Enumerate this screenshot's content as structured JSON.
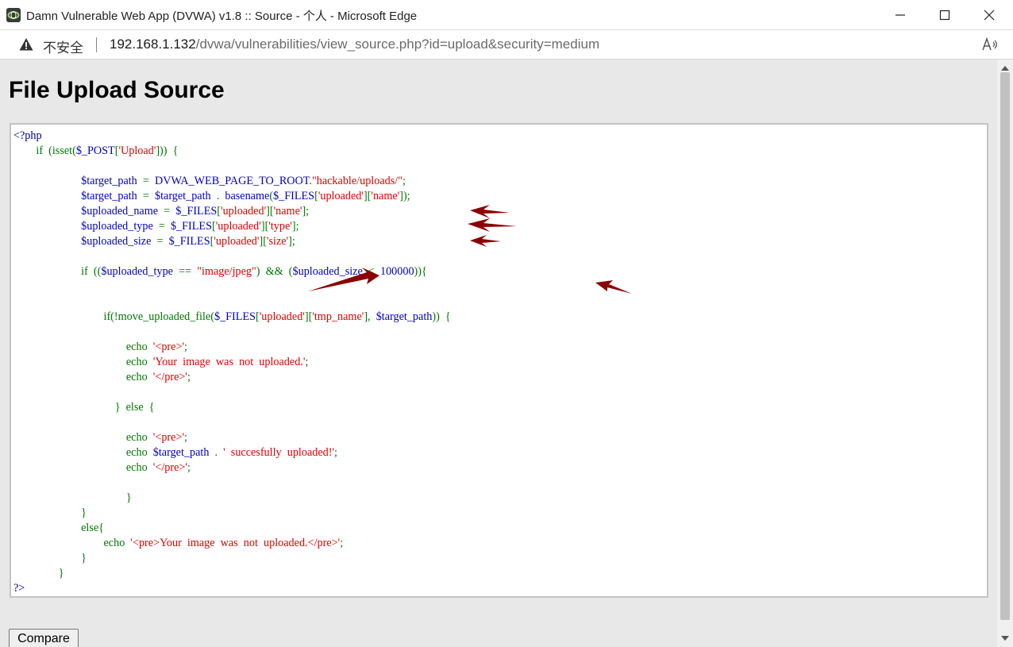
{
  "window": {
    "title": "Damn Vulnerable Web App (DVWA) v1.8 :: Source - 个人 - Microsoft Edge",
    "minimize_icon": "minimize-icon",
    "maximize_icon": "maximize-icon",
    "close_icon": "close-icon"
  },
  "addressbar": {
    "security_label": "不安全",
    "url_host": "192.168.1.132",
    "url_path": "/dvwa/vulnerabilities/view_source.php?id=upload&security=medium",
    "warning_icon": "warning-icon",
    "read_aloud_icon": "read-aloud-icon"
  },
  "page": {
    "title": "File Upload Source",
    "compare_label": "Compare"
  },
  "code": [
    [
      [
        "t",
        "<?php"
      ]
    ],
    [
      [
        "p",
        "        "
      ],
      [
        "k",
        "if  (isset("
      ],
      [
        "v",
        "$_POST"
      ],
      [
        "k",
        "["
      ],
      [
        "s",
        "'Upload'"
      ],
      [
        "k",
        "]))  {"
      ]
    ],
    [
      [
        "p",
        ""
      ]
    ],
    [
      [
        "p",
        "                        "
      ],
      [
        "v",
        "$target_path  "
      ],
      [
        "k",
        "=  "
      ],
      [
        "v",
        "DVWA_WEB_PAGE_TO_ROOT"
      ],
      [
        "k",
        "."
      ],
      [
        "s",
        "\"hackable/uploads/\""
      ],
      [
        "k",
        ";"
      ]
    ],
    [
      [
        "p",
        "                        "
      ],
      [
        "v",
        "$target_path  "
      ],
      [
        "k",
        "=  "
      ],
      [
        "v",
        "$target_path  "
      ],
      [
        "k",
        ".  "
      ],
      [
        "v",
        "basename"
      ],
      [
        "k",
        "("
      ],
      [
        "v",
        "$_FILES"
      ],
      [
        "k",
        "["
      ],
      [
        "s",
        "'uploaded'"
      ],
      [
        "k",
        "]["
      ],
      [
        "s",
        "'name'"
      ],
      [
        "k",
        "]);"
      ]
    ],
    [
      [
        "p",
        "                        "
      ],
      [
        "v",
        "$uploaded_name  "
      ],
      [
        "k",
        "=  "
      ],
      [
        "v",
        "$_FILES"
      ],
      [
        "k",
        "["
      ],
      [
        "s",
        "'uploaded'"
      ],
      [
        "k",
        "]["
      ],
      [
        "s",
        "'name'"
      ],
      [
        "k",
        "];"
      ]
    ],
    [
      [
        "p",
        "                        "
      ],
      [
        "v",
        "$uploaded_type  "
      ],
      [
        "k",
        "=  "
      ],
      [
        "v",
        "$_FILES"
      ],
      [
        "k",
        "["
      ],
      [
        "s",
        "'uploaded'"
      ],
      [
        "k",
        "]["
      ],
      [
        "s",
        "'type'"
      ],
      [
        "k",
        "];"
      ]
    ],
    [
      [
        "p",
        "                        "
      ],
      [
        "v",
        "$uploaded_size  "
      ],
      [
        "k",
        "=  "
      ],
      [
        "v",
        "$_FILES"
      ],
      [
        "k",
        "["
      ],
      [
        "s",
        "'uploaded'"
      ],
      [
        "k",
        "]["
      ],
      [
        "s",
        "'size'"
      ],
      [
        "k",
        "];"
      ]
    ],
    [
      [
        "p",
        ""
      ]
    ],
    [
      [
        "p",
        "                        "
      ],
      [
        "k",
        "if  (("
      ],
      [
        "v",
        "$uploaded_type  "
      ],
      [
        "k",
        "==  "
      ],
      [
        "s",
        "\"image/jpeg\""
      ],
      [
        "k",
        ")  &&  ("
      ],
      [
        "v",
        "$uploaded_size  "
      ],
      [
        "k",
        "<  "
      ],
      [
        "v",
        "100000"
      ],
      [
        "k",
        ")){"
      ]
    ],
    [
      [
        "p",
        ""
      ]
    ],
    [
      [
        "p",
        ""
      ]
    ],
    [
      [
        "p",
        "                                "
      ],
      [
        "k",
        "if(!move_uploaded_file("
      ],
      [
        "v",
        "$_FILES"
      ],
      [
        "k",
        "["
      ],
      [
        "s",
        "'uploaded'"
      ],
      [
        "k",
        "]["
      ],
      [
        "s",
        "'tmp_name'"
      ],
      [
        "k",
        "],  "
      ],
      [
        "v",
        "$target_path"
      ],
      [
        "k",
        "))  {"
      ]
    ],
    [
      [
        "p",
        ""
      ]
    ],
    [
      [
        "p",
        "                                        "
      ],
      [
        "k",
        "echo  "
      ],
      [
        "s",
        "'<pre>'"
      ],
      [
        "k",
        ";"
      ]
    ],
    [
      [
        "p",
        "                                        "
      ],
      [
        "k",
        "echo  "
      ],
      [
        "s",
        "'Your  image  was  not  uploaded.'"
      ],
      [
        "k",
        ";"
      ]
    ],
    [
      [
        "p",
        "                                        "
      ],
      [
        "k",
        "echo  "
      ],
      [
        "s",
        "'</pre>'"
      ],
      [
        "k",
        ";"
      ]
    ],
    [
      [
        "p",
        ""
      ]
    ],
    [
      [
        "p",
        "                                    "
      ],
      [
        "k",
        "}  else  {"
      ]
    ],
    [
      [
        "p",
        ""
      ]
    ],
    [
      [
        "p",
        "                                        "
      ],
      [
        "k",
        "echo  "
      ],
      [
        "s",
        "'<pre>'"
      ],
      [
        "k",
        ";"
      ]
    ],
    [
      [
        "p",
        "                                        "
      ],
      [
        "k",
        "echo  "
      ],
      [
        "v",
        "$target_path  "
      ],
      [
        "k",
        ".  "
      ],
      [
        "s",
        "'  succesfully  uploaded!'"
      ],
      [
        "k",
        ";"
      ]
    ],
    [
      [
        "p",
        "                                        "
      ],
      [
        "k",
        "echo  "
      ],
      [
        "s",
        "'</pre>'"
      ],
      [
        "k",
        ";"
      ]
    ],
    [
      [
        "p",
        ""
      ]
    ],
    [
      [
        "p",
        "                                        "
      ],
      [
        "k",
        "}"
      ]
    ],
    [
      [
        "p",
        "                        "
      ],
      [
        "k",
        "}"
      ]
    ],
    [
      [
        "p",
        "                        "
      ],
      [
        "k",
        "else{"
      ]
    ],
    [
      [
        "p",
        "                                "
      ],
      [
        "k",
        "echo  "
      ],
      [
        "s",
        "'<pre>Your  image  was  not  uploaded.</pre>'"
      ],
      [
        "k",
        ";"
      ]
    ],
    [
      [
        "p",
        "                        "
      ],
      [
        "k",
        "}"
      ]
    ],
    [
      [
        "p",
        "                "
      ],
      [
        "k",
        "}"
      ]
    ],
    [
      [
        "t",
        "?>"
      ]
    ]
  ],
  "colors": {
    "php_tag": "#000088",
    "keyword": "#007700",
    "string": "#dd0000",
    "variable": "#0000bb",
    "annotation_arrow": "#8b0000"
  }
}
